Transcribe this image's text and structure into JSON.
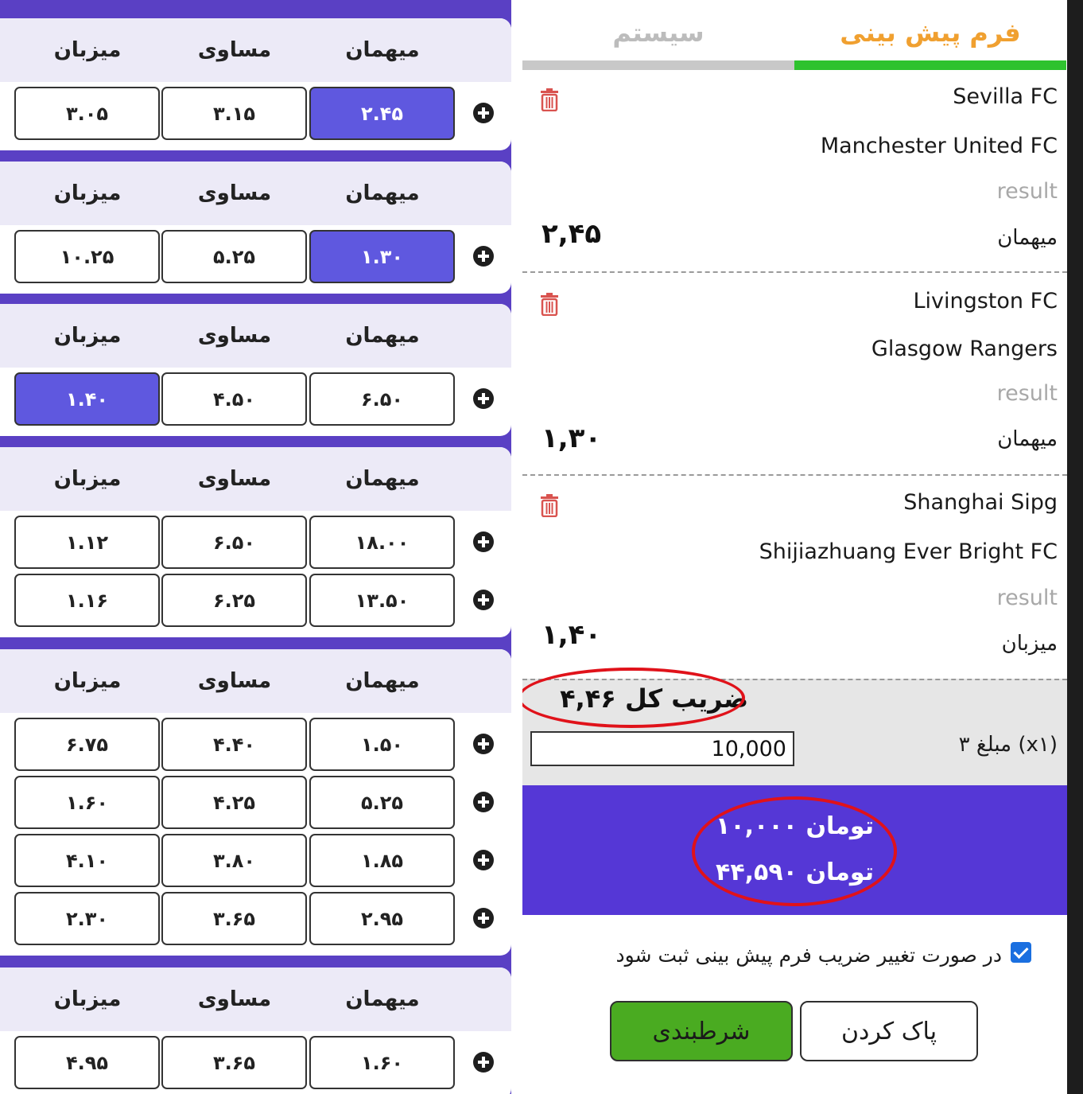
{
  "headers": {
    "host": "میزبان",
    "draw": "مساوی",
    "guest": "میهمان"
  },
  "cards": [
    {
      "rows": [
        {
          "host": "۳.۰۵",
          "draw": "۳.۱۵",
          "guest": "۲.۴۵",
          "selected": "guest"
        }
      ]
    },
    {
      "rows": [
        {
          "host": "۱۰.۲۵",
          "draw": "۵.۲۵",
          "guest": "۱.۳۰",
          "selected": "guest"
        }
      ]
    },
    {
      "rows": [
        {
          "host": "۱.۴۰",
          "draw": "۴.۵۰",
          "guest": "۶.۵۰",
          "selected": "host"
        }
      ]
    },
    {
      "rows": [
        {
          "host": "۱.۱۲",
          "draw": "۶.۵۰",
          "guest": "۱۸.۰۰"
        },
        {
          "host": "۱.۱۶",
          "draw": "۶.۲۵",
          "guest": "۱۳.۵۰"
        }
      ]
    },
    {
      "rows": [
        {
          "host": "۶.۷۵",
          "draw": "۴.۴۰",
          "guest": "۱.۵۰"
        },
        {
          "host": "۱.۶۰",
          "draw": "۴.۲۵",
          "guest": "۵.۲۵"
        },
        {
          "host": "۴.۱۰",
          "draw": "۳.۸۰",
          "guest": "۱.۸۵"
        },
        {
          "host": "۲.۳۰",
          "draw": "۳.۶۵",
          "guest": "۲.۹۵"
        }
      ]
    },
    {
      "rows": [
        {
          "host": "۴.۹۵",
          "draw": "۳.۶۵",
          "guest": "۱.۶۰"
        }
      ]
    }
  ],
  "tabs": {
    "system": "سیستم",
    "form": "فرم پیش بینی"
  },
  "bets": [
    {
      "team1": "Sevilla FC",
      "team2": "Manchester United FC",
      "market": "result",
      "pick": "میهمان",
      "odd": "۲,۴۵"
    },
    {
      "team1": "Livingston FC",
      "team2": "Glasgow Rangers",
      "market": "result",
      "pick": "میهمان",
      "odd": "۱,۳۰"
    },
    {
      "team1": "Shanghai Sipg",
      "team2": "Shijiazhuang Ever Bright FC",
      "market": "result",
      "pick": "میزبان",
      "odd": "۱,۴۰"
    }
  ],
  "summary": {
    "total_odd": "ضریب کل ۴,۴۶",
    "stake_label": "۳ مبلغ (x۱)",
    "stake_value": "10,000"
  },
  "totals": {
    "stake": "۱۰,۰۰۰ تومان",
    "payout": "۴۴,۵۹۰ تومان"
  },
  "confirm": {
    "text": "در صورت تغییر ضریب فرم پیش بینی ثبت شود",
    "checked": true
  },
  "buttons": {
    "bet": "شرطبندی",
    "clear": "پاک کردن"
  },
  "colors": {
    "accent_purple": "#5537d6",
    "selected_odd": "#5f58df",
    "bet_button": "#4aab21",
    "tab_active": "#2ec22e",
    "highlight": "#e0121a"
  }
}
